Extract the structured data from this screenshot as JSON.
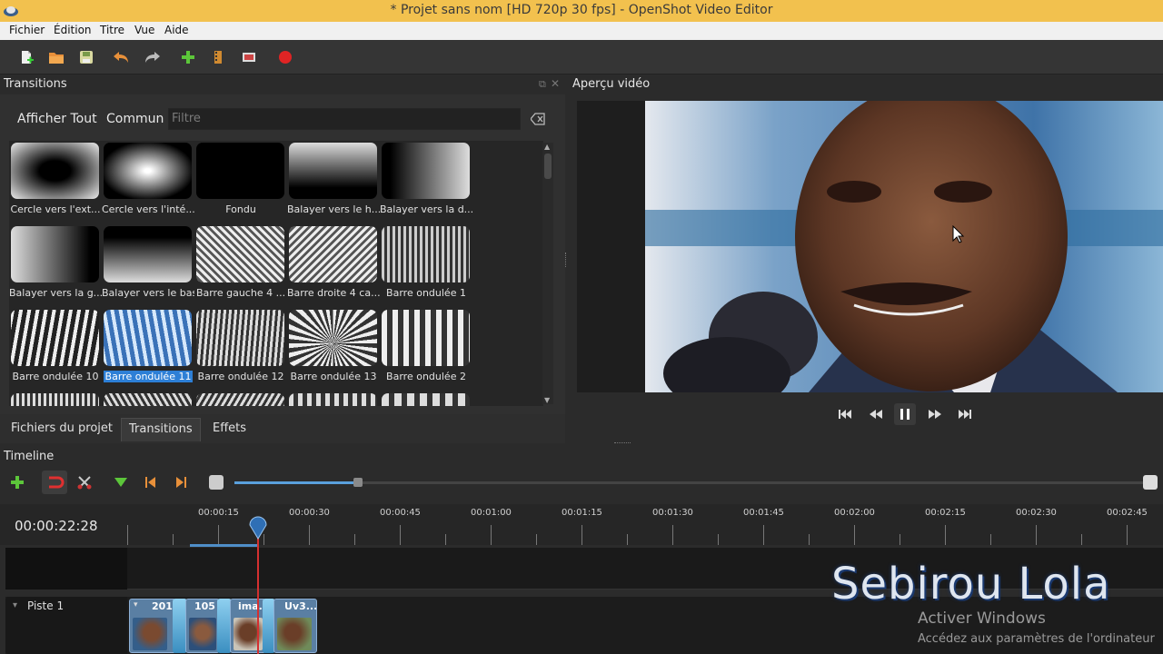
{
  "window": {
    "title": "* Projet sans nom [HD 720p 30 fps] - OpenShot Video Editor"
  },
  "menu": {
    "items": [
      "Fichier",
      "Édition",
      "Titre",
      "Vue",
      "Aide"
    ]
  },
  "toolbar": {
    "icons": [
      "new-file-icon",
      "open-folder-icon",
      "save-icon",
      "undo-icon",
      "redo-icon",
      "import-files-icon",
      "choose-profile-icon",
      "fullscreen-icon",
      "record-icon"
    ]
  },
  "transitions_panel": {
    "title": "Transitions",
    "filter_all": "Afficher Tout",
    "filter_common": "Commun",
    "filter_placeholder": "Filtre",
    "items": [
      "Cercle vers l'ext...",
      "Cercle vers l'inté...",
      "Fondu",
      "Balayer vers le h...",
      "Balayer vers la d...",
      "Balayer vers la g...",
      "Balayer vers le bas",
      "Barre gauche 4 ...",
      "Barre droite 4 ca...",
      "Barre ondulée 1",
      "Barre ondulée 10",
      "Barre ondulée 11",
      "Barre ondulée 12",
      "Barre ondulée 13",
      "Barre ondulée 2"
    ],
    "selected": "Barre ondulée 11"
  },
  "tabs": {
    "files": "Fichiers du projet",
    "transitions": "Transitions",
    "effects": "Effets"
  },
  "preview": {
    "title": "Aperçu vidéo"
  },
  "timeline": {
    "title": "Timeline",
    "timecode": "00:00:22:28",
    "ticks": [
      "00:00:15",
      "00:00:30",
      "00:00:45",
      "00:01:00",
      "00:01:15",
      "00:01:30",
      "00:01:45",
      "00:02:00",
      "00:02:15",
      "00:02:30",
      "00:02:45"
    ],
    "track_name": "Piste 1",
    "clips": [
      "201",
      "105",
      "ima...",
      "Uv3..."
    ]
  },
  "overlay": {
    "watermark": "Sebirou Lola",
    "activate_title": "Activer Windows",
    "activate_sub": "Accédez aux paramètres de l'ordinateur"
  },
  "colors": {
    "titlebar": "#f2c14e",
    "accent": "#2d7fd6",
    "playhead": "#d43030",
    "clip": "#5a7fa3"
  }
}
